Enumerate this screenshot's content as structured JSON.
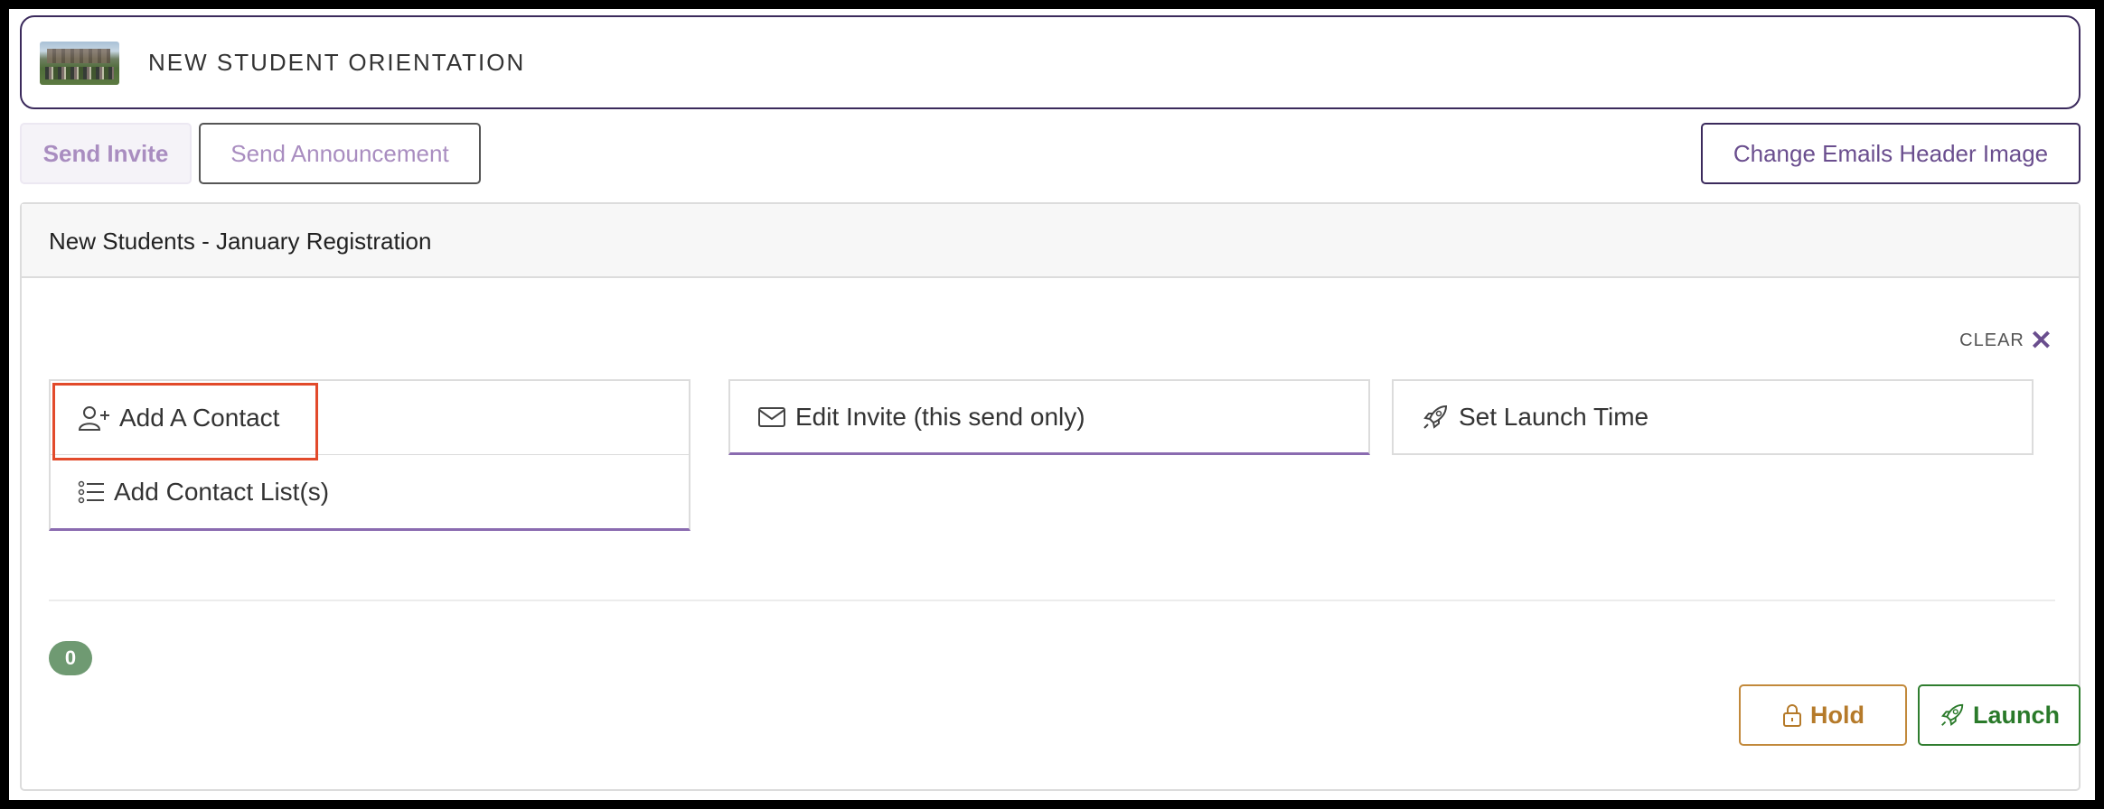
{
  "header": {
    "title": "NEW STUDENT ORIENTATION",
    "thumbnail_alt": "orientation-photo"
  },
  "toolbar": {
    "send_invite": "Send Invite",
    "send_announcement": "Send Announcement",
    "change_header_image": "Change Emails Header Image"
  },
  "panel": {
    "title": "New Students - January Registration",
    "clear_label": "CLEAR",
    "cards": {
      "add_contact": "Add A Contact",
      "add_contact_list": "Add Contact List(s)",
      "edit_invite": "Edit Invite (this send only)",
      "set_launch_time": "Set Launch Time"
    },
    "count": "0",
    "hold_label": "Hold",
    "launch_label": "Launch"
  },
  "colors": {
    "accent_purple": "#6a4e8e",
    "highlight_red": "#e24a2b",
    "badge_green": "#6f9a72",
    "hold_amber": "#b57a2a",
    "launch_green": "#2a7a2a"
  }
}
